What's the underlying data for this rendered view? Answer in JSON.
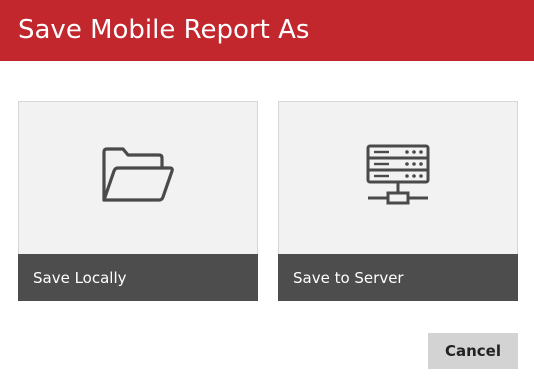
{
  "dialog": {
    "title": "Save Mobile Report As"
  },
  "options": [
    {
      "label": "Save Locally",
      "icon": "folder-open-icon"
    },
    {
      "label": "Save to Server",
      "icon": "server-network-icon"
    }
  ],
  "actions": {
    "cancel_label": "Cancel"
  },
  "colors": {
    "title_bar": "#c1272d",
    "tile_background": "#f2f2f2",
    "tile_caption": "#4d4d4d",
    "icon_stroke": "#4a4a4a",
    "cancel_background": "#d3d3d3"
  }
}
